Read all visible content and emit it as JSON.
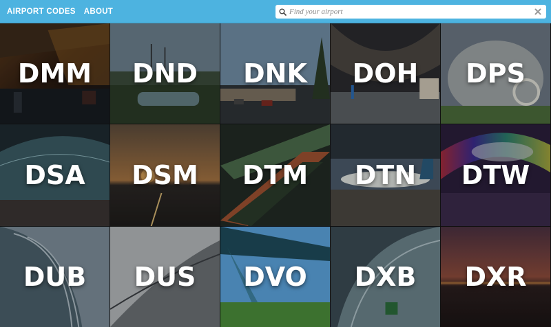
{
  "header": {
    "brand": "AIRPORT CODES",
    "about": "ABOUT"
  },
  "search": {
    "placeholder": "Find your airport",
    "value": "",
    "icon": "search-icon",
    "clear_icon": "close-icon"
  },
  "colors": {
    "topbar": "#4db3e0",
    "text": "#ffffff"
  },
  "tiles": [
    {
      "code": "DMM"
    },
    {
      "code": "DND"
    },
    {
      "code": "DNK"
    },
    {
      "code": "DOH"
    },
    {
      "code": "DPS"
    },
    {
      "code": "DSA"
    },
    {
      "code": "DSM"
    },
    {
      "code": "DTM"
    },
    {
      "code": "DTN"
    },
    {
      "code": "DTW"
    },
    {
      "code": "DUB"
    },
    {
      "code": "DUS"
    },
    {
      "code": "DVO"
    },
    {
      "code": "DXB"
    },
    {
      "code": "DXR"
    }
  ]
}
